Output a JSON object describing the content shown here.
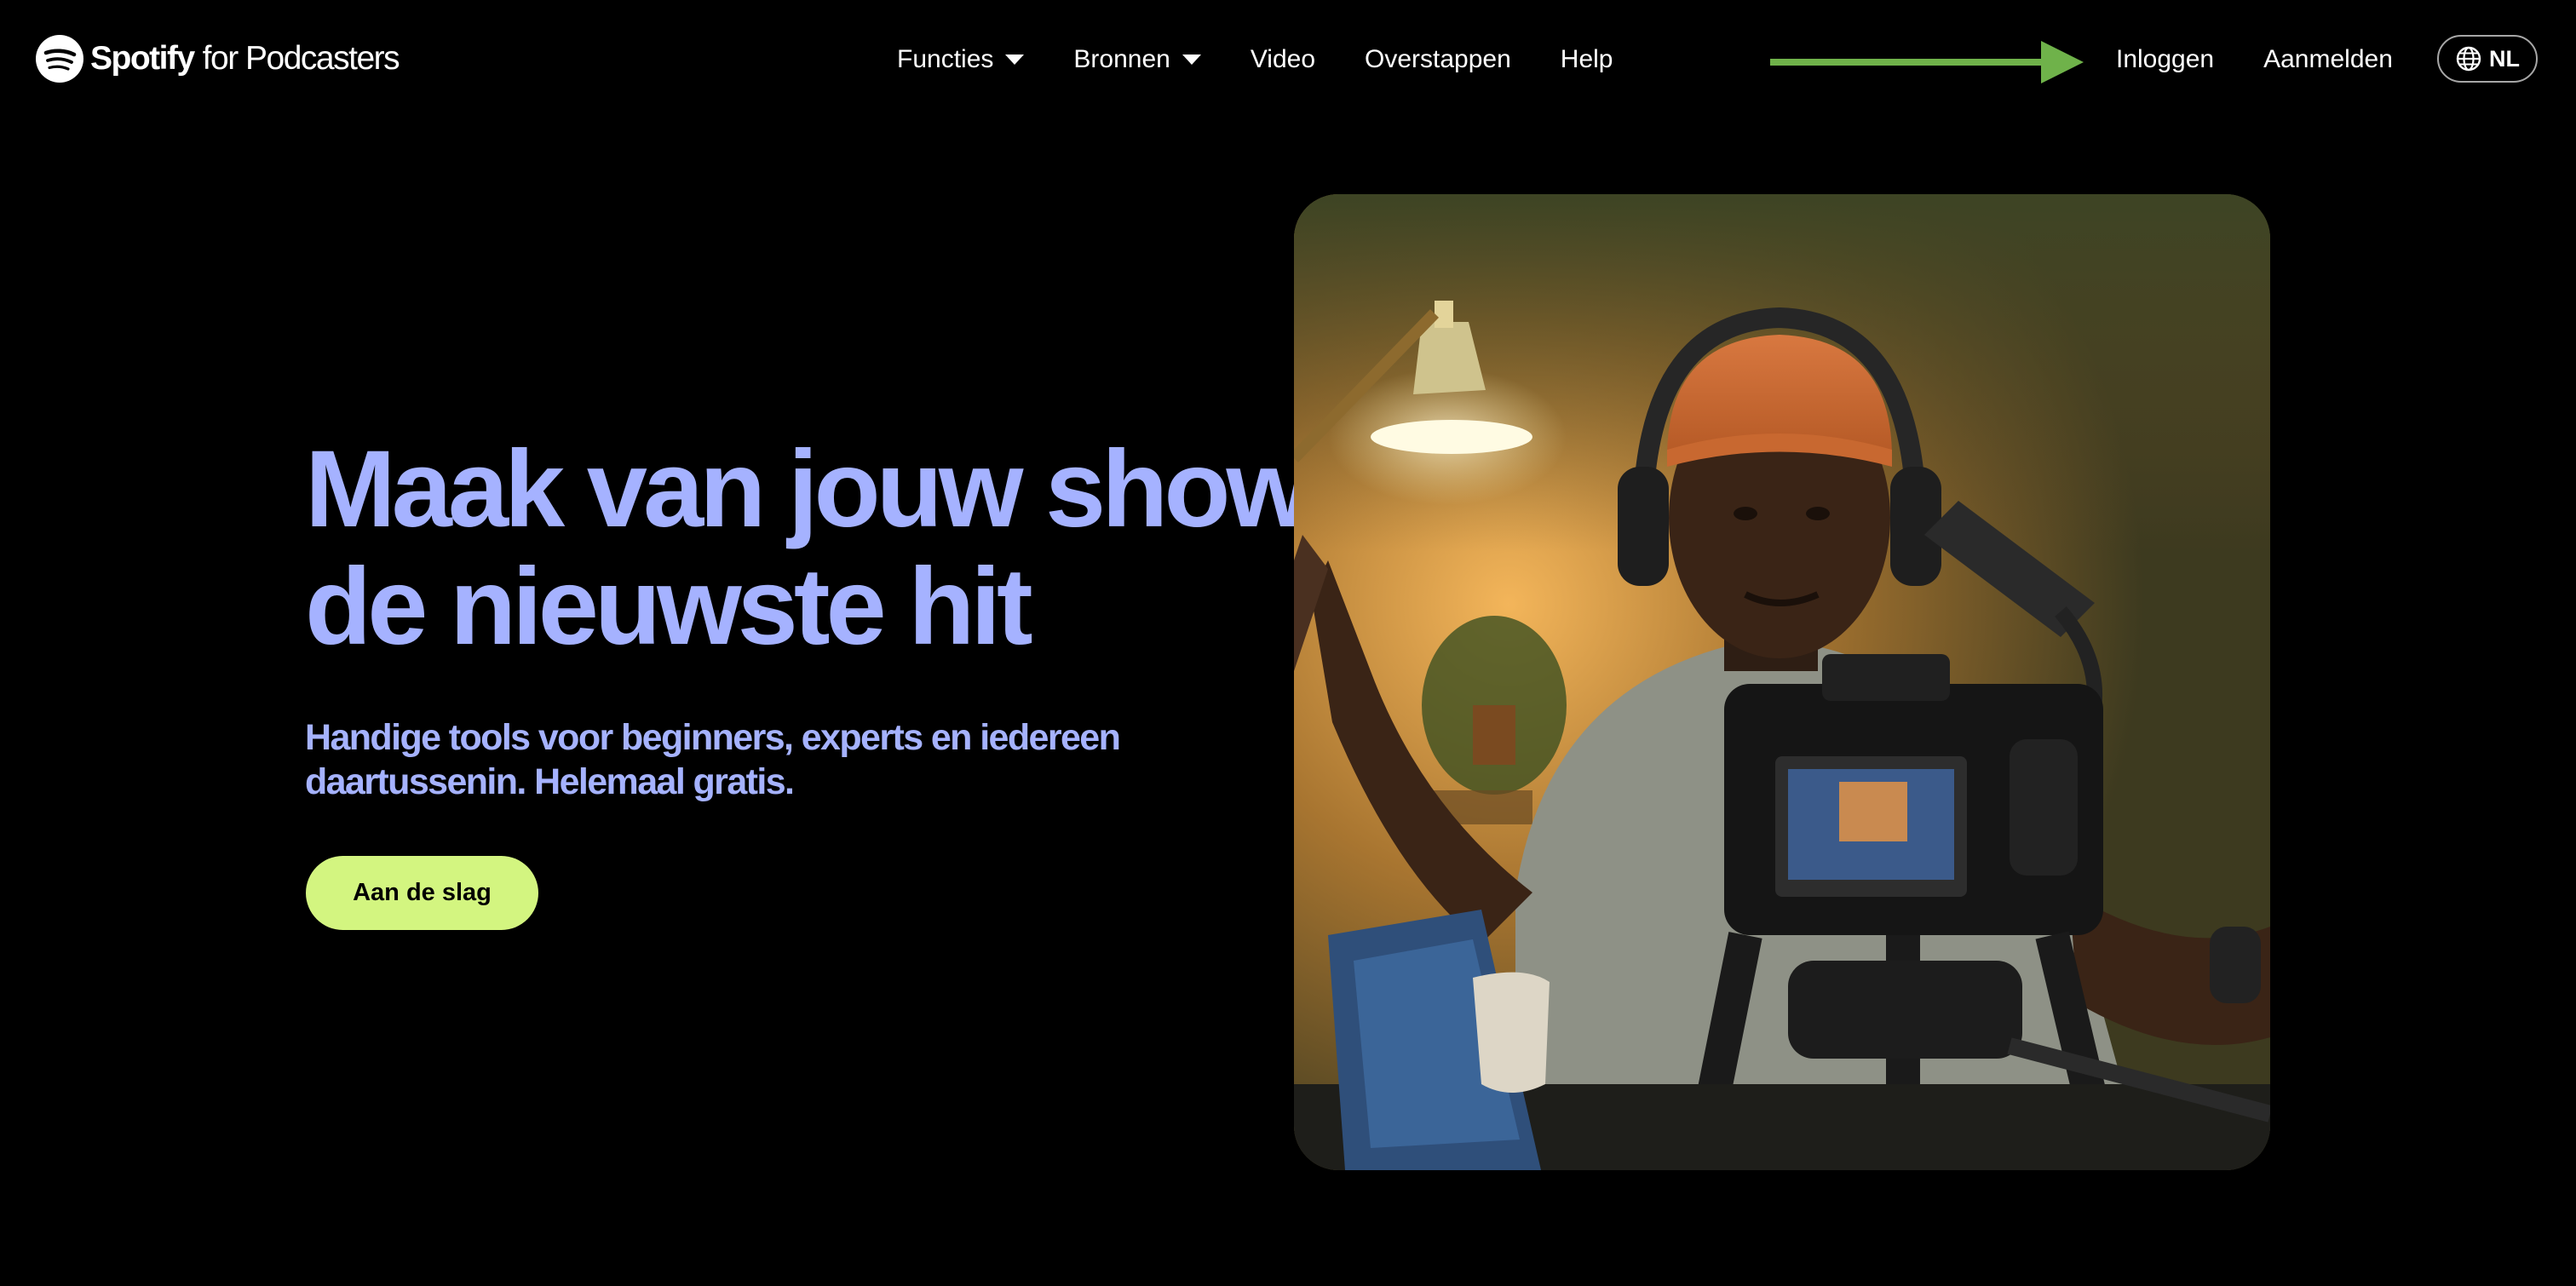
{
  "header": {
    "logo": {
      "brand": "Spotify",
      "suffix": "for Podcasters",
      "icon": "spotify-logo-icon"
    },
    "nav": [
      {
        "label": "Functies",
        "has_dropdown": true
      },
      {
        "label": "Bronnen",
        "has_dropdown": true
      },
      {
        "label": "Video",
        "has_dropdown": false
      },
      {
        "label": "Overstappen",
        "has_dropdown": false
      },
      {
        "label": "Help",
        "has_dropdown": false
      }
    ],
    "auth": {
      "login": "Inloggen",
      "signup": "Aanmelden"
    },
    "language": {
      "code": "NL",
      "icon": "globe-icon"
    },
    "annotation_arrow": {
      "color": "#6fb24a",
      "points_to": "Inloggen"
    }
  },
  "hero": {
    "title_line1": "Maak van jouw show",
    "title_line2": "de nieuwste hit",
    "subtitle": "Handige tools voor beginners, experts en iedereen daartussenin. Helemaal gratis.",
    "cta_label": "Aan de slag",
    "image_subject": "podcaster-with-headphones-and-camera"
  },
  "colors": {
    "background": "#000000",
    "headline": "#a5b2ff",
    "cta_background": "#d3f580",
    "cta_text": "#000000",
    "nav_text": "#ffffff"
  }
}
